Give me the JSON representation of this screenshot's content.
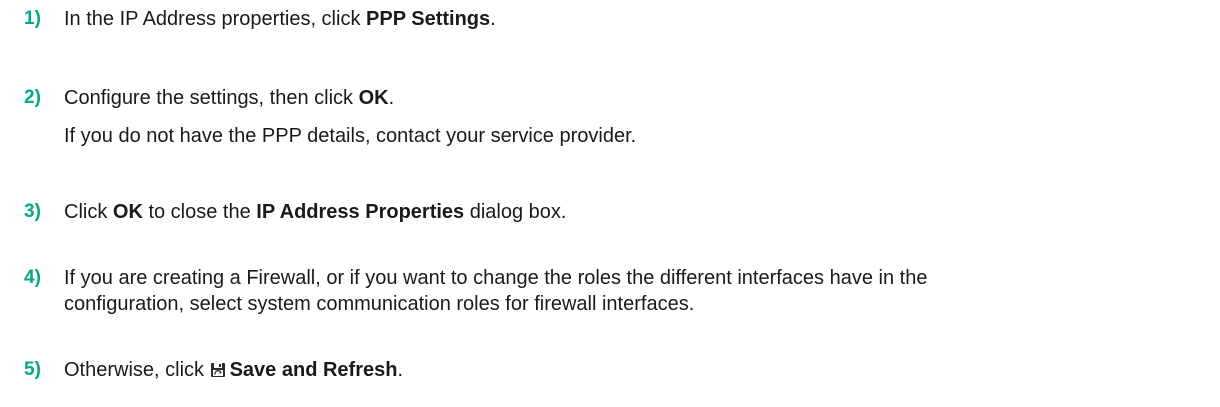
{
  "steps": [
    {
      "number": "1)",
      "text_before": "In the IP Address properties, click ",
      "bold": "PPP Settings",
      "text_after": "."
    },
    {
      "number": "2)",
      "text_before": "Configure the settings, then click ",
      "bold": "OK",
      "text_after": ".",
      "note": "If you do not have the PPP details, contact your service provider."
    },
    {
      "number": "3)",
      "text_before": "Click ",
      "bold1": "OK",
      "text_middle": " to close the ",
      "bold2": "IP Address Properties",
      "text_after": " dialog box."
    },
    {
      "number": "4)",
      "line1": "If you are creating a Firewall, or if you want to change the roles the different interfaces have in the",
      "line2": "configuration, select system communication roles for firewall interfaces."
    },
    {
      "number": "5)",
      "text_before": "Otherwise, click ",
      "icon": "save-refresh-icon",
      "bold": "Save and Refresh",
      "text_after": "."
    }
  ],
  "colors": {
    "step_number": "#01a982",
    "body_text": "#1a1a1a"
  }
}
